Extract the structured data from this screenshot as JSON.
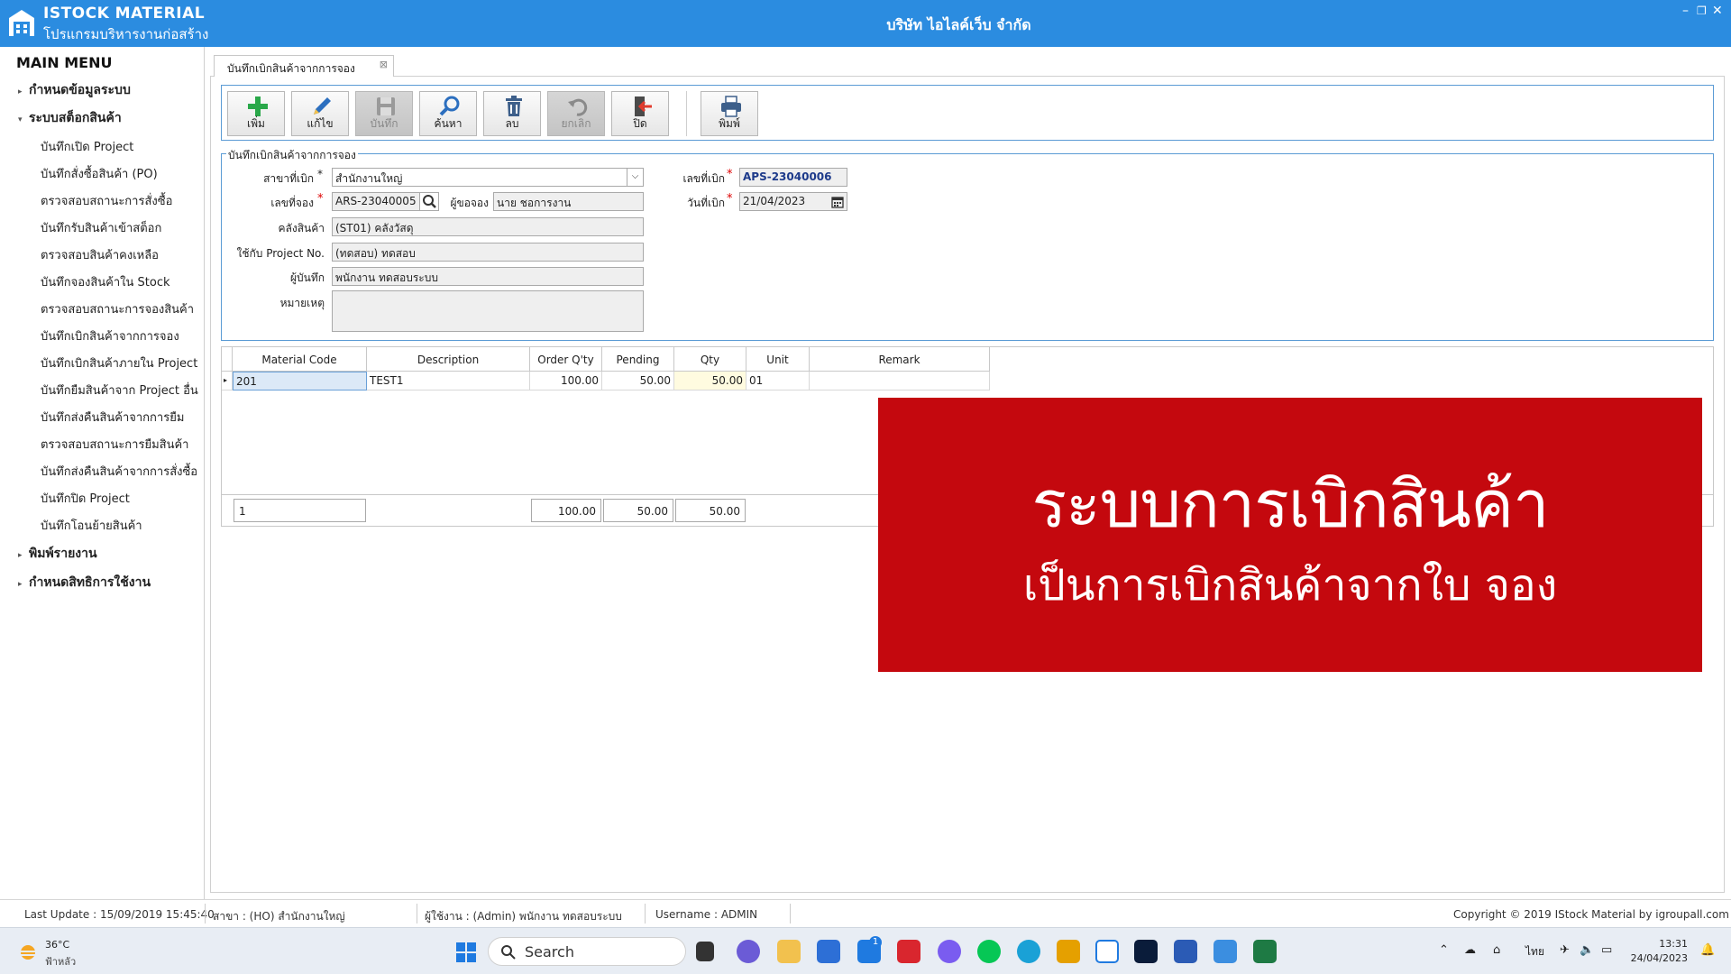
{
  "app": {
    "brand_line1": "ISTOCK MATERIAL",
    "brand_line2": "โปรแกรมบริหารงานก่อสร้าง",
    "company": "บริษัท ไอไลค์เว็บ จำกัด"
  },
  "sidebar": {
    "title": "MAIN MENU",
    "groups": [
      {
        "label": "กำหนดข้อมูลระบบ",
        "arrow": "▸"
      },
      {
        "label": "ระบบสต็อกสินค้า",
        "arrow": "▾"
      },
      {
        "label": "พิมพ์รายงาน",
        "arrow": "▸"
      },
      {
        "label": "กำหนดสิทธิการใช้งาน",
        "arrow": "▸"
      }
    ],
    "items": [
      "บันทึกเปิด Project",
      "บันทึกสั่งซื้อสินค้า (PO)",
      "ตรวจสอบสถานะการสั่งซื้อ",
      "บันทึกรับสินค้าเข้าสต็อก",
      "ตรวจสอบสินค้าคงเหลือ",
      "บันทึกจองสินค้าใน Stock",
      "ตรวจสอบสถานะการจองสินค้า",
      "บันทึกเบิกสินค้าจากการจอง",
      "บันทึกเบิกสินค้าภายใน Project",
      "บันทึกยืมสินค้าจาก Project อื่น",
      "บันทึกส่งคืนสินค้าจากการยืม",
      "ตรวจสอบสถานะการยืมสินค้า",
      "บันทึกส่งคืนสินค้าจากการสั่งซื้อ",
      "บันทึกปิด Project",
      "บันทึกโอนย้ายสินค้า"
    ]
  },
  "tab": {
    "label": "บันทึกเบิกสินค้าจากการจอง"
  },
  "toolbar": {
    "add": "เพิ่ม",
    "edit": "แก้ไข",
    "save": "บันทึก",
    "search": "ค้นหา",
    "delete": "ลบ",
    "cancel": "ยกเลิก",
    "close": "ปิด",
    "print": "พิมพ์"
  },
  "form": {
    "group_title": "บันทึกเบิกสินค้าจากการจอง",
    "branch_label": "สาขาที่เบิก",
    "branch_value": "สำนักงานใหญ่",
    "booking_no_label": "เลขที่จอง",
    "booking_no_value": "ARS-23040005",
    "requester_label": "ผู้ขอจอง",
    "requester_value": "นาย ชอการงาน",
    "warehouse_label": "คลังสินค้า",
    "warehouse_value": "(ST01) คลังวัสดุ",
    "project_label": "ใช้กับ Project No.",
    "project_value": "(ทดสอบ) ทดสอบ",
    "recorder_label": "ผู้บันทึก",
    "recorder_value": "พนักงาน ทดสอบระบบ",
    "remark_label": "หมายเหตุ",
    "remark_value": "",
    "withdraw_no_label": "เลขที่เบิก",
    "withdraw_no_value": "APS-23040006",
    "withdraw_date_label": "วันที่เบิก",
    "withdraw_date_value": "21/04/2023",
    "required_mark": "*"
  },
  "grid": {
    "columns": [
      "Material Code",
      "Description",
      "Order Q'ty",
      "Pending",
      "Qty",
      "Unit",
      "Remark"
    ],
    "rows": [
      {
        "code": "201",
        "description": "TEST1",
        "order_qty": "100.00",
        "pending": "50.00",
        "qty": "50.00",
        "unit": "01",
        "remark": ""
      }
    ],
    "totals": {
      "count": "1",
      "order_qty": "100.00",
      "pending": "50.00",
      "qty": "50.00"
    }
  },
  "banner": {
    "title": "ระบบการเบิกสินค้า",
    "subtitle": "เป็นการเบิกสินค้าจากใบ จอง"
  },
  "status": {
    "last_update": "Last Update : 15/09/2019 15:45:40",
    "branch": "สาขา : (HO) สำนักงานใหญ่",
    "user": "ผู้ใช้งาน : (Admin) พนักงาน ทดสอบระบบ",
    "username": "Username : ADMIN",
    "copyright": "Copyright © 2019 IStock Material by igroupall.com"
  },
  "taskbar": {
    "weather_temp": "36°C",
    "weather_desc": "ฟ้าหลัว",
    "search_label": "Search",
    "mail_badge": "1",
    "lang": "ไทย",
    "time": "13:31",
    "date": "24/04/2023"
  },
  "colors": {
    "titlebar": "#2b8ce0",
    "banner": "#c4080e",
    "accent_border": "#5b9bd5"
  }
}
